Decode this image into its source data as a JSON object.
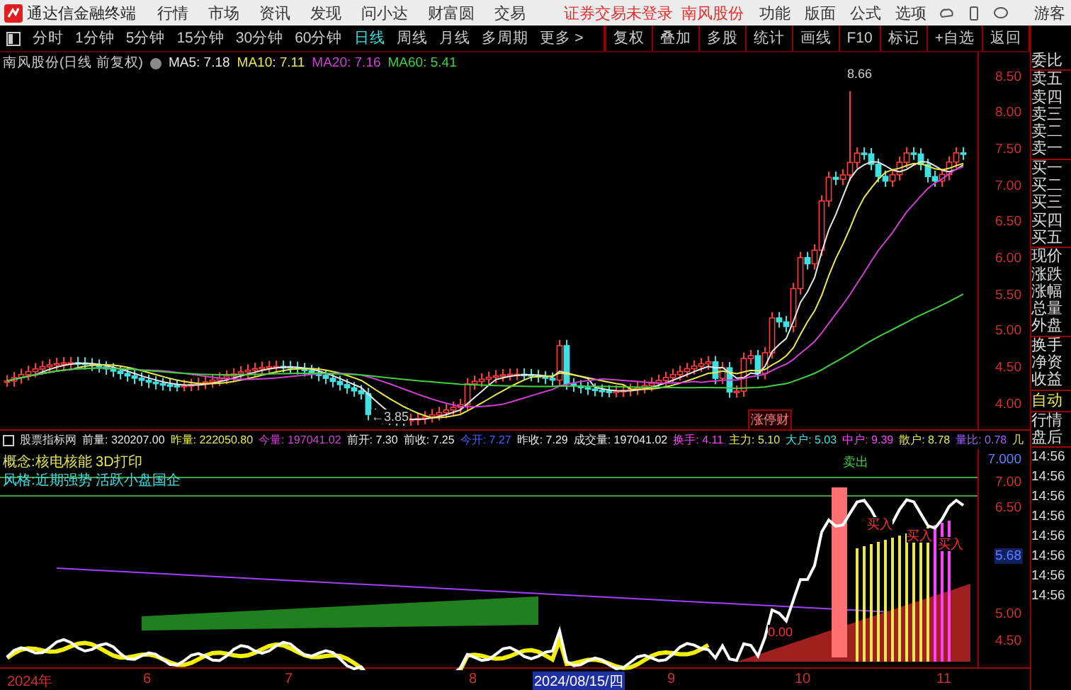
{
  "app": {
    "title": "通达信金融终端",
    "menu": [
      "行情",
      "市场",
      "资讯",
      "发现",
      "问小达",
      "财富圆",
      "交易"
    ],
    "login_notice": "证券交易未登录",
    "stock_link": "南风股份",
    "tools": [
      "功能",
      "版面",
      "公式",
      "选项"
    ],
    "user": "游客"
  },
  "periods": [
    {
      "label": "分时",
      "selected": false
    },
    {
      "label": "1分钟",
      "selected": false
    },
    {
      "label": "5分钟",
      "selected": false
    },
    {
      "label": "15分钟",
      "selected": false
    },
    {
      "label": "30分钟",
      "selected": false
    },
    {
      "label": "60分钟",
      "selected": false
    },
    {
      "label": "日线",
      "selected": true
    },
    {
      "label": "周线",
      "selected": false
    },
    {
      "label": "月线",
      "selected": false
    },
    {
      "label": "多周期",
      "selected": false
    },
    {
      "label": "更多 >",
      "selected": false
    }
  ],
  "actions": [
    "复权",
    "叠加",
    "多股",
    "统计",
    "画线",
    "F10",
    "标记",
    "+自选",
    "返回"
  ],
  "chart": {
    "title": "南风股份(日线 前复权)",
    "ma": [
      {
        "label": "MA5: 7.18",
        "color": "#e8e8e8"
      },
      {
        "label": "MA10: 7.11",
        "color": "#e8e850"
      },
      {
        "label": "MA20: 7.16",
        "color": "#d040d0"
      },
      {
        "label": "MA60: 5.41",
        "color": "#40d040"
      }
    ],
    "price_labels": [
      "8.50",
      "8.00",
      "7.50",
      "7.00",
      "6.50",
      "6.00",
      "5.50",
      "5.00",
      "4.50",
      "4.00"
    ],
    "high_label": "8.66",
    "low_label": "←3.85",
    "badge": "涨停财"
  },
  "indicator": {
    "name": "股票指标网",
    "fields": [
      {
        "text": "前量: 320207.00",
        "color": "#e8e8e8"
      },
      {
        "text": "昨量: 222050.80",
        "color": "#e8e850"
      },
      {
        "text": "今量: 197041.02",
        "color": "#d040d0"
      },
      {
        "text": "前开: 7.30",
        "color": "#e8e8e8"
      },
      {
        "text": "前收: 7.25",
        "color": "#e8e8e8"
      },
      {
        "text": "今开: 7.27",
        "color": "#4060ff"
      },
      {
        "text": "昨收: 7.29",
        "color": "#e8e8e8"
      },
      {
        "text": "成交量: 197041.02",
        "color": "#e8e8e8"
      },
      {
        "text": "换手: 4.11",
        "color": "#ff40ff"
      },
      {
        "text": "主力: 5.10",
        "color": "#e8e850"
      },
      {
        "text": "大户: 5.03",
        "color": "#40e0e0"
      },
      {
        "text": "中户: 9.39",
        "color": "#ff40ff"
      },
      {
        "text": "散户: 8.78",
        "color": "#e8e850"
      },
      {
        "text": "量比: 0.78",
        "color": "#a060ff"
      },
      {
        "text": "几",
        "color": "#e8e850"
      }
    ],
    "notes": [
      {
        "label": "概念:",
        "value": "核电核能 3D打印",
        "color": "#e8e850"
      },
      {
        "label": "风格:",
        "value": "近期强势 活跃小盘国企",
        "color": "#40e0e0"
      }
    ],
    "signals": [
      {
        "text": "卖出",
        "color": "#40d040"
      },
      {
        "text": "买入",
        "color": "#ff3030"
      },
      {
        "text": "买入",
        "color": "#ff3030"
      },
      {
        "text": "买入",
        "color": "#ff3030"
      },
      {
        "text": "0.00",
        "color": "#ff3030"
      }
    ],
    "axis_labels": [
      "7.000",
      "7.00",
      "6.50",
      "5.68",
      "5.00",
      "4.50"
    ]
  },
  "dates": [
    {
      "label": "2024年",
      "selected": false
    },
    {
      "label": "6",
      "selected": false
    },
    {
      "label": "7",
      "selected": false
    },
    {
      "label": "8",
      "selected": false
    },
    {
      "label": "2024/08/15/四",
      "selected": true
    },
    {
      "label": "9",
      "selected": false
    },
    {
      "label": "10",
      "selected": false
    },
    {
      "label": "11",
      "selected": false
    }
  ],
  "quote_panel": [
    [
      "委比"
    ],
    [
      "卖五",
      "卖四",
      "卖三",
      "卖二",
      "卖一"
    ],
    [
      "买一",
      "买二",
      "买三",
      "买四",
      "买五"
    ],
    [
      "现价",
      "涨跌",
      "涨幅",
      "总量",
      "外盘"
    ],
    [
      "换手",
      "净资",
      "收益"
    ]
  ],
  "mode_panel": {
    "auto": "自动",
    "items": [
      "行情",
      "盘后"
    ],
    "times": [
      "14:56",
      "14:56",
      "14:56",
      "14:56",
      "14:56",
      "14:56",
      "14:56",
      "14:56"
    ]
  }
}
